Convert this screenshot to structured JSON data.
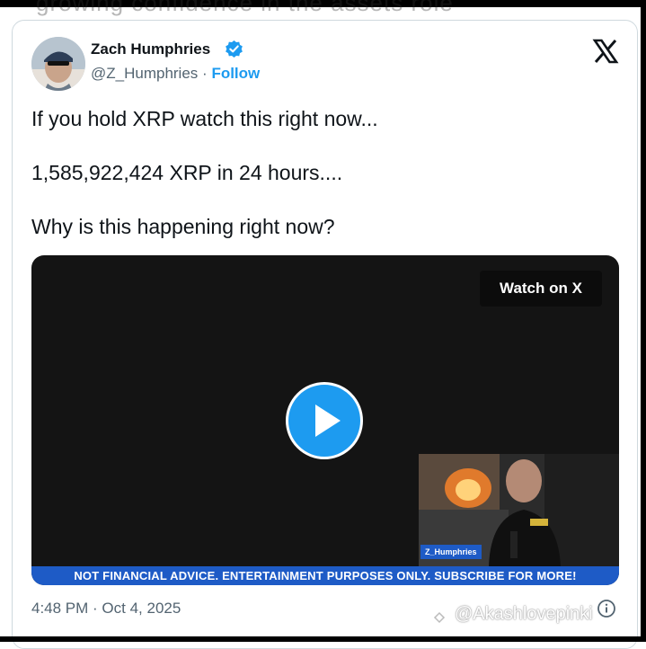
{
  "background_text": "growing confidence in the assets role",
  "author": {
    "name": "Zach Humphries",
    "handle": "@Z_Humphries",
    "separator": "·",
    "follow_label": "Follow"
  },
  "tweet": {
    "lines": [
      "If you hold XRP watch this right now...",
      "1,585,922,424 XRP in 24 hours....",
      "Why is this happening right now?"
    ]
  },
  "video": {
    "watch_label": "Watch on X",
    "pip_label": "Z_Humphries",
    "banner_text": "NOT FINANCIAL ADVICE. ENTERTAINMENT PURPOSES ONLY. SUBSCRIBE FOR MORE!"
  },
  "meta": {
    "timestamp": "4:48 PM · Oct 4, 2025"
  },
  "watermark": "@Akashlovepinki",
  "colors": {
    "accent": "#1d9bf0",
    "banner": "#1e5bc6",
    "text": "#0f1419",
    "muted": "#536471"
  }
}
